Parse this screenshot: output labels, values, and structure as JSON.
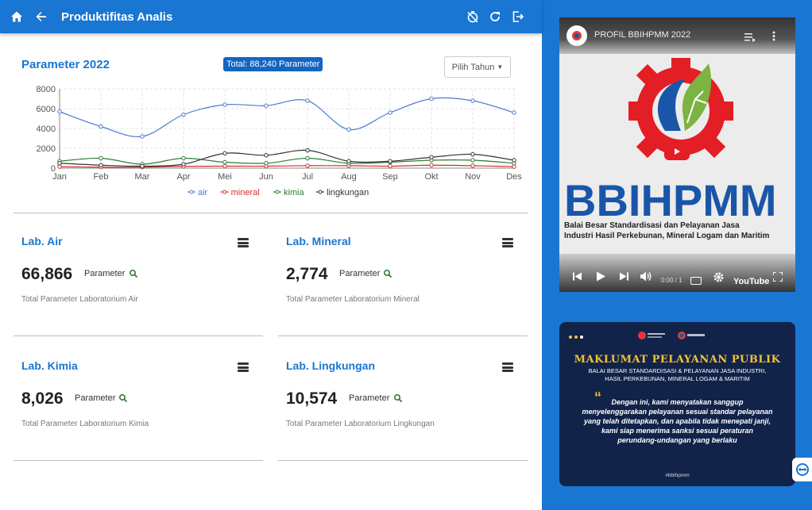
{
  "header": {
    "title": "Produktifitas Analis",
    "icons": [
      "home-icon",
      "back-arrow-icon",
      "timer-off-icon",
      "refresh-icon",
      "logout-icon"
    ]
  },
  "chart_card": {
    "title": "Parameter 2022",
    "total_badge": "Total: 88,240 Parameter",
    "year_select": "Pilih Tahun"
  },
  "chart_data": {
    "type": "line",
    "categories": [
      "Jan",
      "Feb",
      "Mar",
      "Apr",
      "Mei",
      "Jun",
      "Jul",
      "Aug",
      "Sep",
      "Okt",
      "Nov",
      "Des"
    ],
    "ylim": [
      0,
      8000
    ],
    "yticks": [
      "0",
      "2000",
      "4000",
      "6000",
      "8000"
    ],
    "grid": true,
    "legend": "bottom",
    "series": [
      {
        "name": "air",
        "color": "#4a7bd0",
        "values": [
          5700,
          4200,
          3200,
          5400,
          6400,
          6300,
          6800,
          3900,
          5600,
          7000,
          6800,
          5600
        ]
      },
      {
        "name": "mineral",
        "color": "#d32f2f",
        "values": [
          150,
          100,
          100,
          180,
          200,
          200,
          250,
          250,
          200,
          300,
          250,
          150
        ]
      },
      {
        "name": "kimia",
        "color": "#2e7d32",
        "values": [
          700,
          1000,
          400,
          1000,
          600,
          500,
          1000,
          500,
          600,
          800,
          800,
          500
        ]
      },
      {
        "name": "lingkungan",
        "color": "#333333",
        "values": [
          500,
          300,
          200,
          400,
          1500,
          1300,
          1800,
          700,
          700,
          1100,
          1400,
          800
        ]
      }
    ]
  },
  "cards": [
    {
      "title": "Lab. Air",
      "value": "66,866",
      "param_label": "Parameter",
      "desc": "Total Parameter Laboratorium Air"
    },
    {
      "title": "Lab. Mineral",
      "value": "2,774",
      "param_label": "Parameter",
      "desc": "Total Parameter Laboratorium Mineral"
    },
    {
      "title": "Lab. Kimia",
      "value": "8,026",
      "param_label": "Parameter",
      "desc": "Total Parameter Laboratorium Kimia"
    },
    {
      "title": "Lab. Lingkungan",
      "value": "10,574",
      "param_label": "Parameter",
      "desc": "Total Parameter Laboratorium Lingkungan"
    }
  ],
  "video": {
    "title": "PROFIL BBIHPMM 2022",
    "brand": "BBIHPMM",
    "brand_sub_1": "Balai Besar Standardisasi dan Pelayanan Jasa",
    "brand_sub_2": "Industri Hasil Perkebunan, Mineral Logam dan Maritim",
    "time": "0:00 / 1",
    "youtube": "YouTube"
  },
  "poster": {
    "heading": "MAKLUMAT PELAYANAN PUBLIK",
    "sub_1": "BALAI BESAR STANDARDISASI & PELAYANAN JASA INDUSTRI,",
    "sub_2": "HASIL PERKEBUNAN, MINERAL LOGAM & MARITIM",
    "quote": "Dengan ini, kami menyatakan sanggup menyelenggarakan pelayanan sesuai standar pelayanan yang telah ditetapkan, dan apabila tidak menepati janji, kami siap menerima sanksi sesuai peraturan perundang-undangan yang berlaku",
    "hashtag": "#bbihpmm"
  }
}
